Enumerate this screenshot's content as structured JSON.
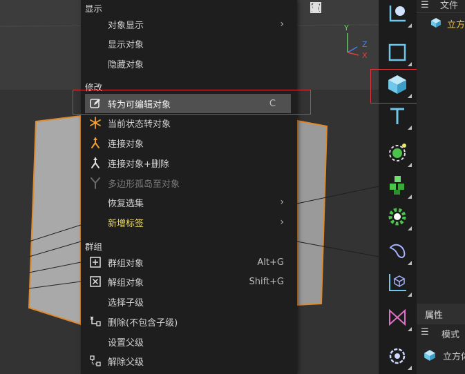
{
  "menu": {
    "sections": {
      "display": "显示",
      "modify": "修改",
      "group": "群组"
    },
    "items": {
      "object_display": "对象显示",
      "show_objects": "显示对象",
      "hide_objects": "隐藏对象",
      "make_editable": "转为可编辑对象",
      "make_editable_shortcut": "C",
      "current_state_to_object": "当前状态转对象",
      "connect_objects": "连接对象",
      "connect_objects_delete": "连接对象+删除",
      "polygon_islands": "多边形孤岛至对象",
      "restore_selection": "恢复选集",
      "new_tag": "新增标签",
      "group_objects": "群组对象",
      "group_objects_shortcut": "Alt+G",
      "ungroup_objects": "解组对象",
      "ungroup_objects_shortcut": "Shift+G",
      "select_children": "选择子级",
      "delete_without_children": "删除(不包含子级)",
      "set_parent": "设置父级",
      "remove_parent": "解除父级"
    }
  },
  "axes": {
    "y": "Y",
    "z": "Z",
    "x": "X"
  },
  "panel": {
    "file_tab": "文件",
    "object_name": "立方",
    "attributes_tab": "属性",
    "mode_label": "模式",
    "object_name2": "立方体"
  },
  "colors": {
    "accent_red": "#e0353b",
    "icon_blue": "#6fc8ea",
    "icon_green": "#4cc44c",
    "icon_orange": "#f0a030",
    "new_tag_yellow": "#e8d86a"
  }
}
